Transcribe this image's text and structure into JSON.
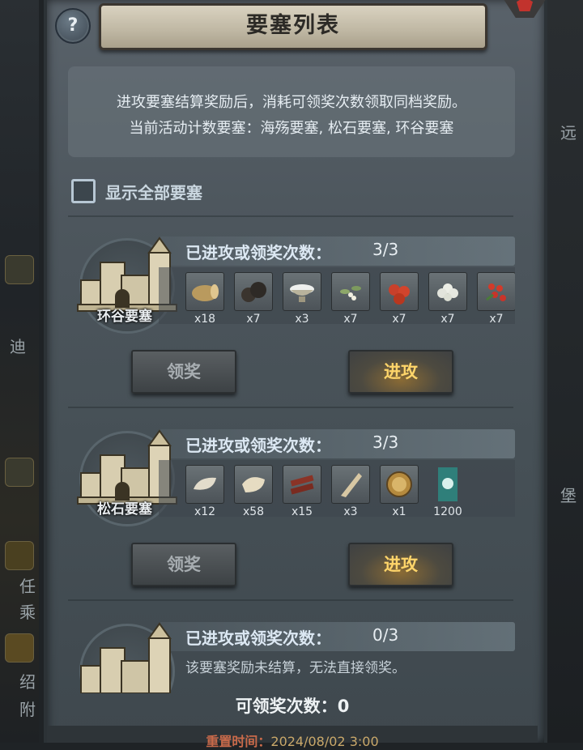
{
  "title": "要塞列表",
  "help_symbol": "?",
  "info": {
    "line1": "进攻要塞结算奖励后，消耗可领奖次数领取同档奖励。",
    "line2": "当前活动计数要塞：海殇要塞, 松石要塞, 环谷要塞"
  },
  "show_all_label": "显示全部要塞",
  "show_all_checked": false,
  "count_label": "已进攻或领奖次数：",
  "claim_label": "领奖",
  "attack_label": "进攻",
  "forts": [
    {
      "name": "环谷要塞",
      "count": "3/3",
      "rewards": [
        {
          "icon": "log-icon",
          "qty": "x18"
        },
        {
          "icon": "truffle-icon",
          "qty": "x7"
        },
        {
          "icon": "salt-bowl-icon",
          "qty": "x3"
        },
        {
          "icon": "mistletoe-icon",
          "qty": "x7"
        },
        {
          "icon": "red-berries-icon",
          "qty": "x7"
        },
        {
          "icon": "white-flower-icon",
          "qty": "x7"
        },
        {
          "icon": "holly-berries-icon",
          "qty": "x7"
        }
      ]
    },
    {
      "name": "松石要塞",
      "count": "3/3",
      "rewards": [
        {
          "icon": "hide-icon",
          "qty": "x12"
        },
        {
          "icon": "fur-pelt-icon",
          "qty": "x58"
        },
        {
          "icon": "wood-planks-icon",
          "qty": "x15"
        },
        {
          "icon": "horn-icon",
          "qty": "x3"
        },
        {
          "icon": "helmet-medal-icon",
          "qty": "x1"
        },
        {
          "icon": "banner-icon",
          "qty": "1200"
        }
      ]
    },
    {
      "name": "",
      "count": "0/3",
      "note": "该要塞奖励未结算，无法直接领奖。"
    }
  ],
  "claimable_count_label": "可领奖次数：",
  "claimable_count": "0",
  "reset_label": "重置时间：",
  "reset_time": "2024/08/02 3:00",
  "bg_left_glyphs": [
    "迪",
    "任",
    "乘",
    "绍",
    "附"
  ],
  "bg_right_glyphs": [
    "远",
    "堡"
  ],
  "colors": {
    "attack_text": "#ffd56a",
    "claim_text": "#a7adb1",
    "panel": "#4d565d"
  }
}
